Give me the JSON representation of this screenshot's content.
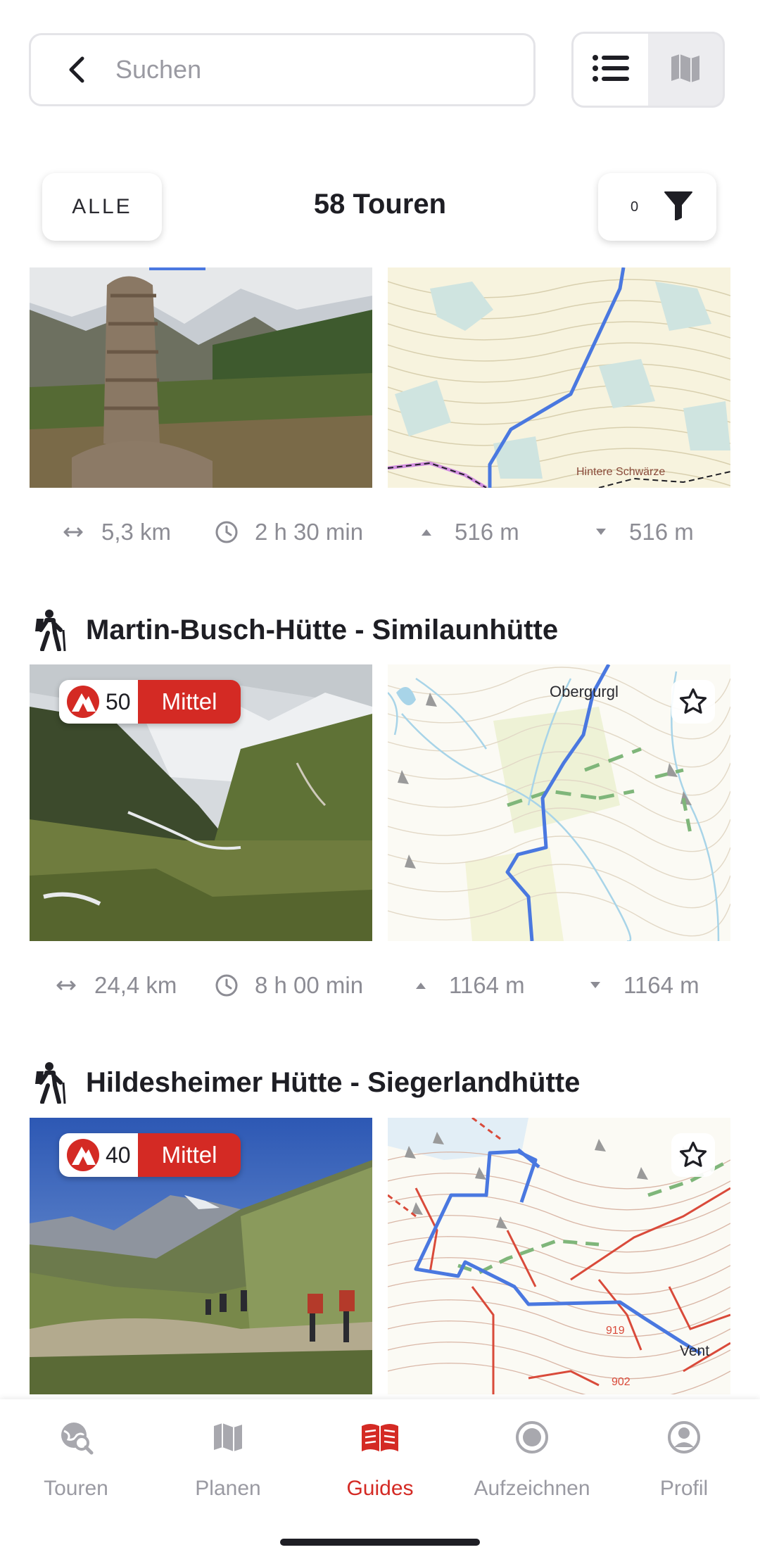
{
  "search": {
    "placeholder": "Suchen"
  },
  "view_toggle": {
    "list_icon": "list-icon",
    "map_icon": "map-icon",
    "active": "list"
  },
  "filter_bar": {
    "all_label": "ALLE",
    "count_title": "58 Touren",
    "filter_count": "0"
  },
  "tours": [
    {
      "name": "",
      "map_label": "Hintere Schwärze",
      "stats": {
        "distance": "5,3 km",
        "duration": "2 h 30 min",
        "ascent": "516 m",
        "descent": "516 m"
      }
    },
    {
      "name": "Martin-Busch-Hütte - Similaunhütte",
      "difficulty_score": "50",
      "difficulty_label": "Mittel",
      "map_label": "Obergurgl",
      "stats": {
        "distance": "24,4 km",
        "duration": "8 h 00 min",
        "ascent": "1164 m",
        "descent": "1164 m"
      }
    },
    {
      "name": "Hildesheimer Hütte - Siegerlandhütte",
      "difficulty_score": "40",
      "difficulty_label": "Mittel",
      "map_label": "Vent",
      "map_numbers": [
        "919",
        "902"
      ]
    }
  ],
  "bottom_nav": [
    {
      "label": "Touren",
      "icon": "globe-search-icon"
    },
    {
      "label": "Planen",
      "icon": "map-icon"
    },
    {
      "label": "Guides",
      "icon": "book-icon",
      "active": true
    },
    {
      "label": "Aufzeichnen",
      "icon": "record-icon"
    },
    {
      "label": "Profil",
      "icon": "profile-icon"
    }
  ],
  "colors": {
    "accent": "#d42a24",
    "route": "#4a78e0",
    "muted_text": "#8c8c94"
  }
}
